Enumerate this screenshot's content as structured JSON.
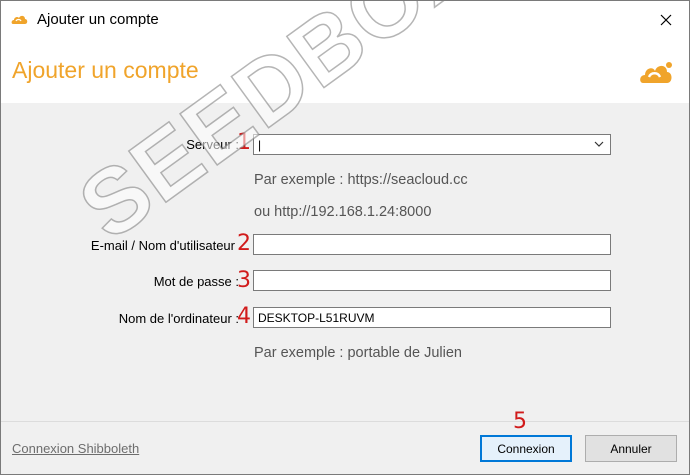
{
  "window": {
    "title": "Ajouter un compte",
    "accent_color": "#f0a42b"
  },
  "header": {
    "title": "Ajouter un compte"
  },
  "form": {
    "server": {
      "label": "Serveur :",
      "marker": "1",
      "value": "|"
    },
    "server_hints": [
      "Par exemple : https://seacloud.cc",
      "ou http://192.168.1.24:8000"
    ],
    "email": {
      "label": "E-mail / Nom d'utilisateur",
      "marker": "2",
      "value": ""
    },
    "password": {
      "label": "Mot de passe :",
      "marker": "3",
      "value": ""
    },
    "computer": {
      "label": "Nom de l'ordinateur :",
      "marker": "4",
      "value": "DESKTOP-L51RUVM"
    },
    "computer_hint": "Par exemple : portable de Julien"
  },
  "footer": {
    "shibboleth_link": "Connexion Shibboleth",
    "connect_marker": "5",
    "connect_label": "Connexion",
    "cancel_label": "Annuler"
  },
  "watermark": "SEEDBOX.FR",
  "icons": {
    "app": "seafile-cloud-icon",
    "close": "close-icon",
    "dropdown": "chevron-down-icon"
  }
}
